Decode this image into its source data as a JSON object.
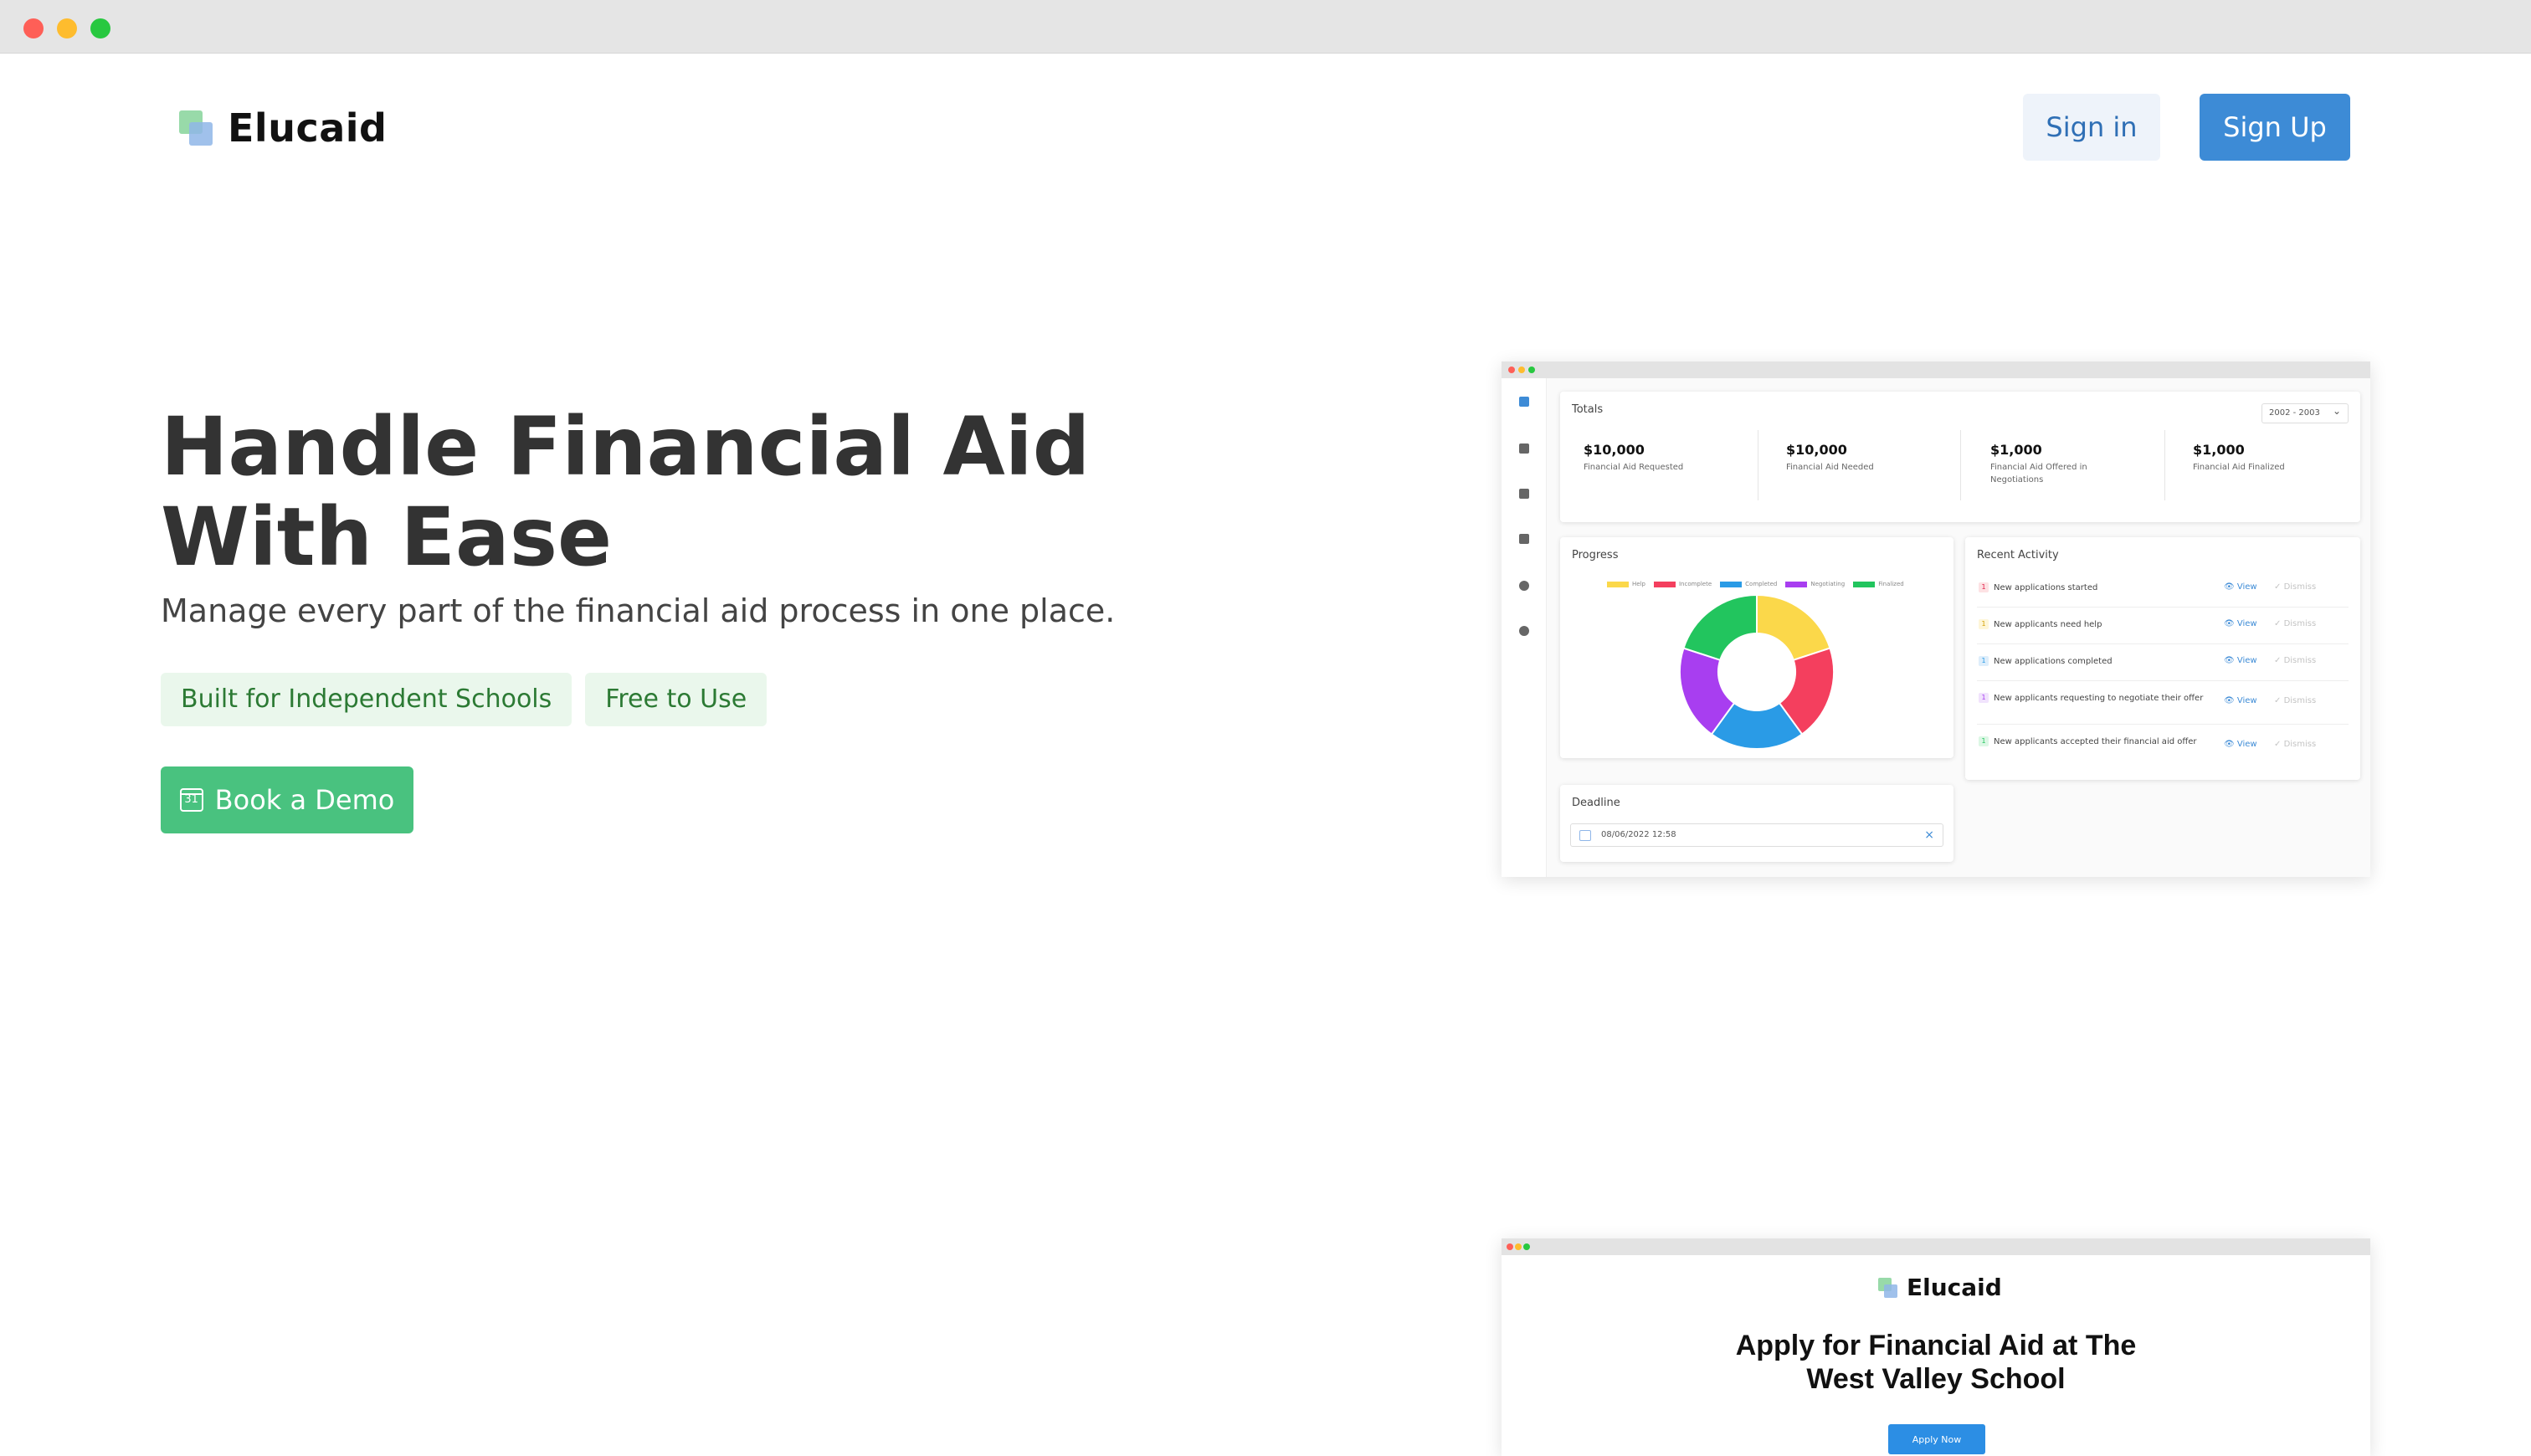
{
  "brand": {
    "name": "Elucaid",
    "colors": {
      "accent": "#3d8bd6",
      "green": "#49c27f"
    }
  },
  "header": {
    "signin_label": "Sign in",
    "signup_label": "Sign Up"
  },
  "hero": {
    "title": "Handle Financial Aid With Ease",
    "subtitle": "Manage every part of the financial aid process in one place.",
    "badges": [
      "Built for Independent Schools",
      "Free to Use"
    ],
    "demo_button": {
      "label": "Book a Demo",
      "icon": "calendar-icon",
      "icon_text": "31"
    }
  },
  "dashboard": {
    "totals": {
      "title": "Totals",
      "year_select": "2002 - 2003",
      "stats": [
        {
          "value": "$10,000",
          "label": "Financial Aid Requested"
        },
        {
          "value": "$10,000",
          "label": "Financial Aid Needed"
        },
        {
          "value": "$1,000",
          "label": "Financial Aid Offered in Negotiations"
        },
        {
          "value": "$1,000",
          "label": "Financial Aid Finalized"
        }
      ]
    },
    "progress": {
      "title": "Progress",
      "legend": [
        "Help",
        "Incomplete",
        "Completed",
        "Negotiating",
        "Finalized"
      ]
    },
    "recent_activity": {
      "title": "Recent Activity",
      "view_label": "View",
      "dismiss_label": "Dismiss",
      "items": [
        {
          "count": "1",
          "text": "New applications started"
        },
        {
          "count": "1",
          "text": "New applicants need help"
        },
        {
          "count": "1",
          "text": "New applications completed"
        },
        {
          "count": "1",
          "text": "New applicants requesting to negotiate their offer"
        },
        {
          "count": "1",
          "text": "New applicants accepted their financial aid offer"
        }
      ]
    },
    "deadline": {
      "title": "Deadline",
      "value": "08/06/2022   12:58"
    }
  },
  "apply_preview": {
    "logo": "Elucaid",
    "title_line1": "Apply for Financial Aid at The",
    "title_line2": "West Valley School",
    "button": "Apply Now"
  },
  "chart_data": {
    "type": "pie",
    "categories": [
      "Help",
      "Incomplete",
      "Completed",
      "Negotiating",
      "Finalized"
    ],
    "values": [
      20,
      20,
      20,
      20,
      20
    ],
    "colors": [
      "#fbd84a",
      "#f43f5e",
      "#2a9be6",
      "#a83ef0",
      "#22c55e"
    ],
    "donut": true
  }
}
